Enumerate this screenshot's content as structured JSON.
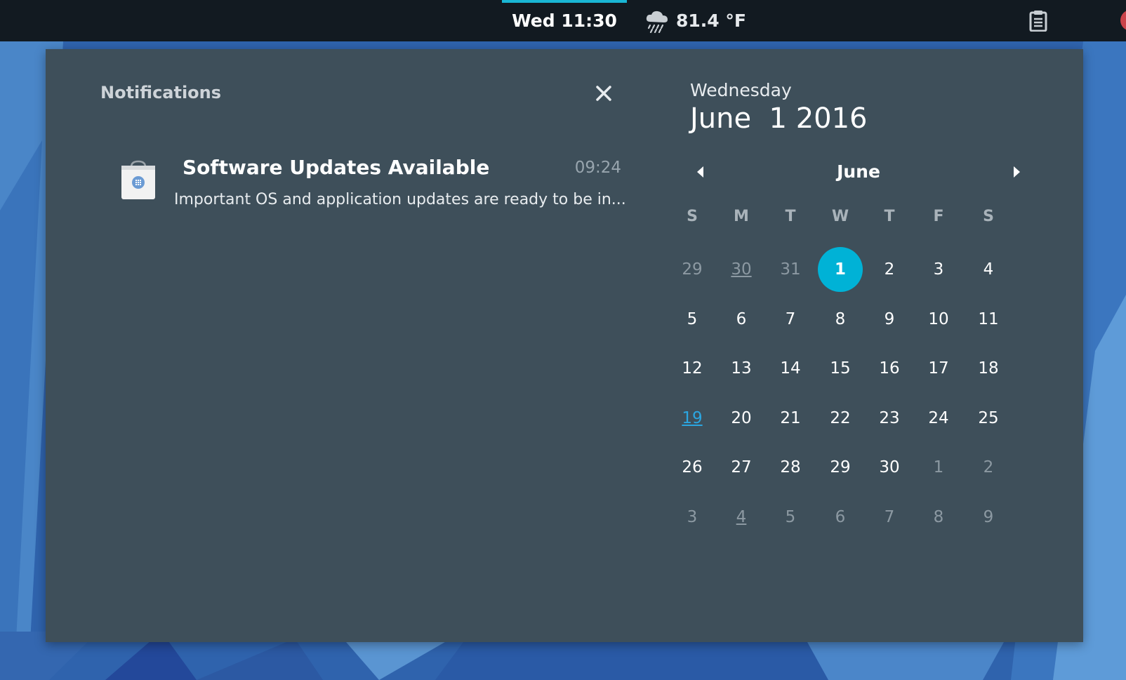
{
  "topbar": {
    "clock": "Wed 11:30",
    "weather_icon": "rain-cloud-icon",
    "temperature": "81.4 °F",
    "clipboard_icon": "clipboard-icon"
  },
  "notifications": {
    "header": "Notifications",
    "close_icon": "close-icon",
    "items": [
      {
        "icon": "software-bag-icon",
        "title": "Software Updates Available",
        "time": "09:24",
        "body": "Important OS and application updates are ready to be in..."
      }
    ]
  },
  "calendar": {
    "weekday": "Wednesday",
    "date": "June  1 2016",
    "month": "June",
    "prev_icon": "chevron-left-icon",
    "next_icon": "chevron-right-icon",
    "weekdays": [
      "S",
      "M",
      "T",
      "W",
      "T",
      "F",
      "S"
    ],
    "weeks": [
      [
        "29",
        "30",
        "31",
        "1",
        "2",
        "3",
        "4"
      ],
      [
        "5",
        "6",
        "7",
        "8",
        "9",
        "10",
        "11"
      ],
      [
        "12",
        "13",
        "14",
        "15",
        "16",
        "17",
        "18"
      ],
      [
        "19",
        "20",
        "21",
        "22",
        "23",
        "24",
        "25"
      ],
      [
        "26",
        "27",
        "28",
        "29",
        "30",
        "1",
        "2"
      ],
      [
        "3",
        "4",
        "5",
        "6",
        "7",
        "8",
        "9"
      ]
    ],
    "today": "1",
    "accent_color": "#00b2d6"
  }
}
